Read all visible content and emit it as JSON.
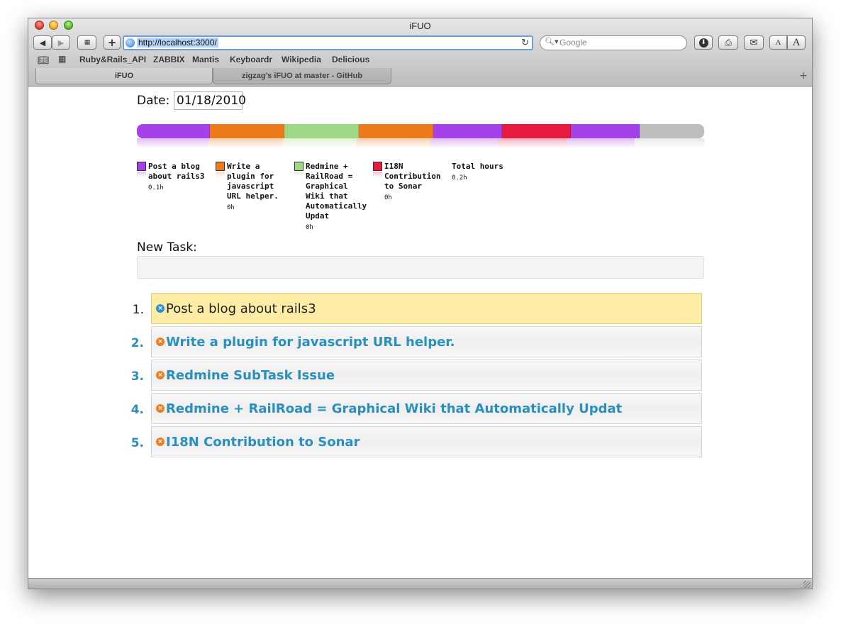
{
  "window": {
    "title": "iFUO"
  },
  "toolbar": {
    "url": "http://localhost:3000/",
    "search_placeholder": "Google",
    "text_smaller": "A",
    "text_larger": "A"
  },
  "bookmarks": [
    "Ruby&Rails_API",
    "ZABBIX",
    "Mantis",
    "Keyboardr",
    "Wikipedia",
    "Delicious"
  ],
  "tabs": [
    {
      "label": "iFUO",
      "active": true
    },
    {
      "label": "zigzag's iFUO at master - GitHub",
      "active": false
    }
  ],
  "page": {
    "date_label": "Date:",
    "date_value": "01/18/2010",
    "new_task_label": "New Task:",
    "new_task_value": ""
  },
  "timeline": {
    "segments": [
      {
        "color": "#a640e8",
        "fraction": 0.128
      },
      {
        "color": "#ee7a1a",
        "fraction": 0.13
      },
      {
        "color": "#9fd884",
        "fraction": 0.13
      },
      {
        "color": "#ee7a1a",
        "fraction": 0.13
      },
      {
        "color": "#a640e8",
        "fraction": 0.12
      },
      {
        "color": "#e8193f",
        "fraction": 0.12
      },
      {
        "color": "#a640e8",
        "fraction": 0.12
      },
      {
        "color": "#bdbdbd",
        "fraction": 0.122
      }
    ]
  },
  "legend": [
    {
      "color": "#a640e8",
      "label": "Post a blog about rails3",
      "hours": "0.1h"
    },
    {
      "color": "#ee7a1a",
      "label": "Write a plugin for javascript URL helper.",
      "hours": "0h"
    },
    {
      "color": "#9fd884",
      "label": "Redmine + RailRoad = Graphical Wiki that Automatically Updat",
      "hours": "0h"
    },
    {
      "color": "#e8193f",
      "label": "I18N Contribution to Sonar",
      "hours": "0h"
    },
    {
      "color": "",
      "label": "Total hours",
      "hours": "0.2h"
    }
  ],
  "tasks": [
    {
      "number": "1.",
      "title": "Post a blog about rails3",
      "active": true
    },
    {
      "number": "2.",
      "title": "Write a plugin for javascript URL helper.",
      "active": false
    },
    {
      "number": "3.",
      "title": "Redmine SubTask Issue",
      "active": false
    },
    {
      "number": "4.",
      "title": "Redmine + RailRoad = Graphical Wiki that Automatically Updat",
      "active": false
    },
    {
      "number": "5.",
      "title": "I18N Contribution to Sonar",
      "active": false
    }
  ],
  "colors": {
    "task_link": "#2a8fbf",
    "active_task_bg": "#ffeda6",
    "icon_active": "#2a8fd6",
    "icon_inactive": "#ef7d20"
  }
}
